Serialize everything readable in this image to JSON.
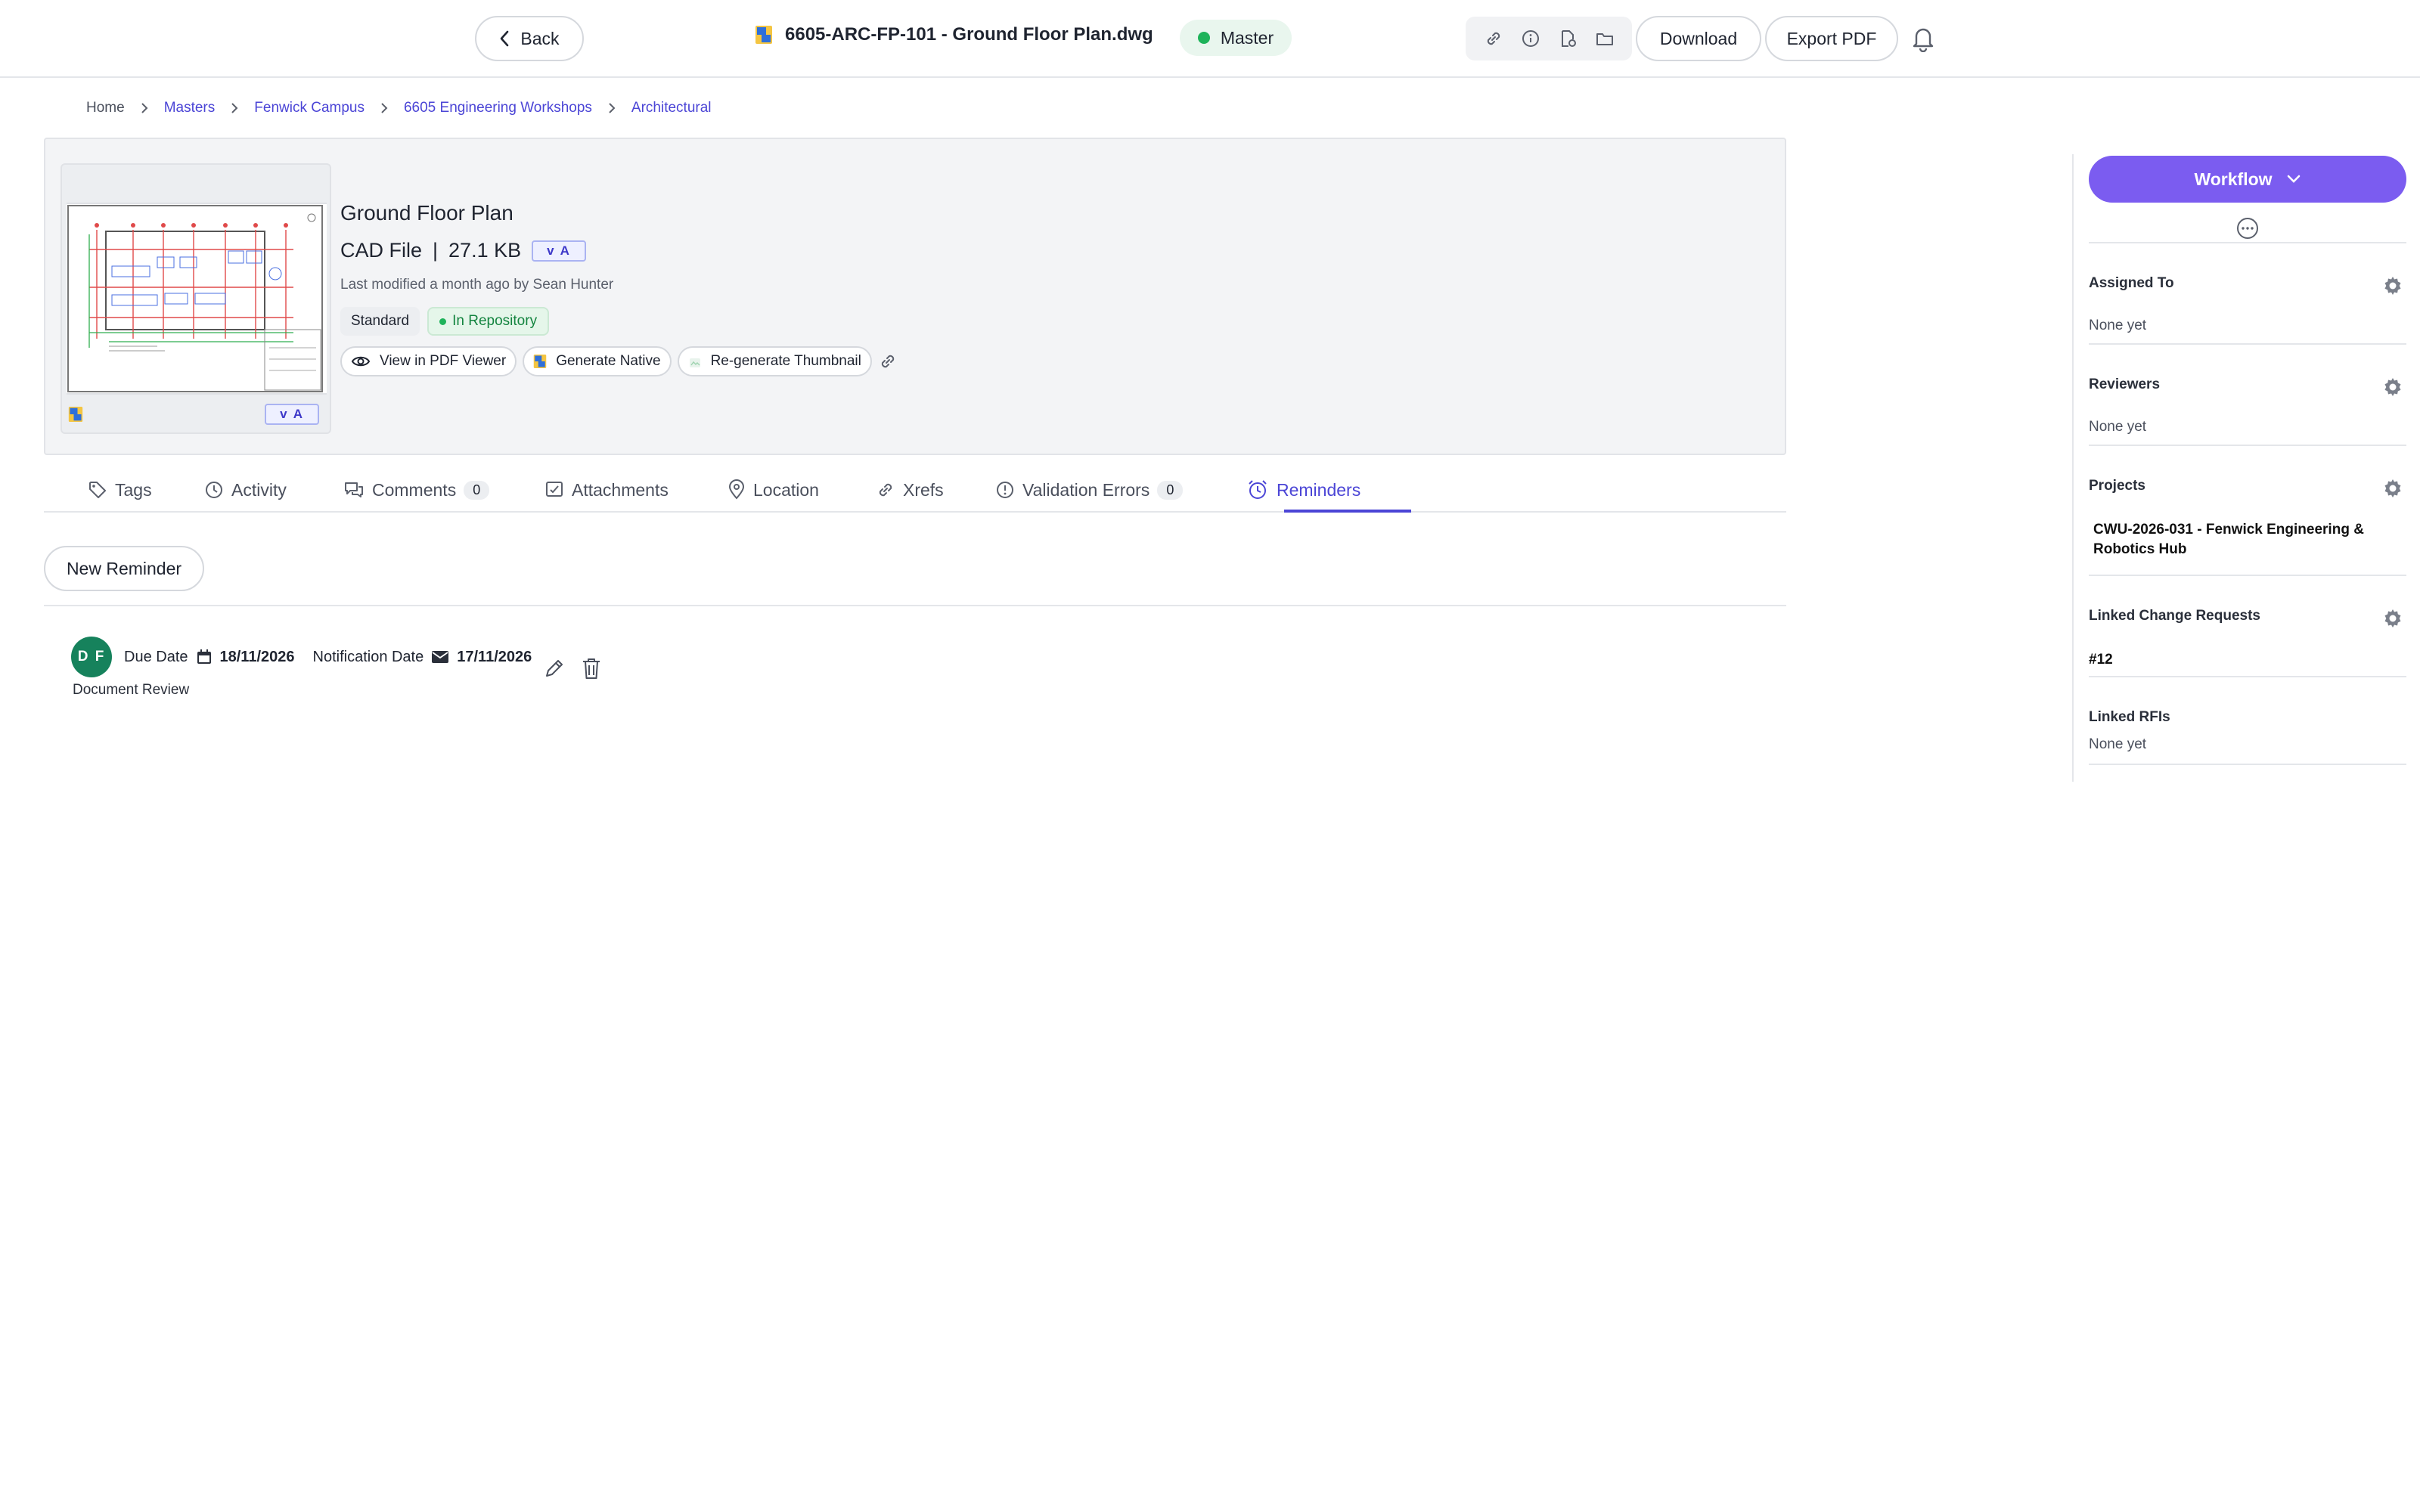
{
  "topbar": {
    "back_label": "Back",
    "file_name": "6605-ARC-FP-101 - Ground Floor Plan.dwg",
    "status_label": "Master",
    "download_label": "Download",
    "export_label": "Export PDF",
    "colors": {
      "status_dot": "#1eb35a",
      "accent": "#4b45d6"
    }
  },
  "breadcrumb": [
    "Home",
    "Masters",
    "Fenwick Campus",
    "6605 Engineering Workshops",
    "Architectural"
  ],
  "file": {
    "title": "Ground Floor Plan",
    "type": "CAD File",
    "separator": "|",
    "size": "27.1 KB",
    "version": "v A",
    "modified": "Last modified a month ago by Sean Hunter",
    "tags": {
      "standard": "Standard",
      "repository": "In Repository"
    },
    "actions": {
      "view_pdf": "View in PDF Viewer",
      "generate_native": "Generate Native",
      "regen_thumb": "Re-generate Thumbnail"
    },
    "thumb_version": "v A"
  },
  "tabs": [
    {
      "label": "Tags",
      "icon": "tag-icon"
    },
    {
      "label": "Activity",
      "icon": "clock-icon"
    },
    {
      "label": "Comments",
      "icon": "comments-icon",
      "count": "0"
    },
    {
      "label": "Attachments",
      "icon": "attachment-icon"
    },
    {
      "label": "Location",
      "icon": "location-pin-icon"
    },
    {
      "label": "Xrefs",
      "icon": "link-icon"
    },
    {
      "label": "Validation Errors",
      "icon": "alert-circle-icon",
      "count": "0"
    },
    {
      "label": "Reminders",
      "icon": "alarm-clock-icon",
      "active": true
    }
  ],
  "reminders": {
    "new_label": "New Reminder",
    "items": [
      {
        "initials": "D F",
        "due_label": "Due Date",
        "due_date": "18/11/2026",
        "notify_label": "Notification Date",
        "notify_date": "17/11/2026",
        "title": "Document Review"
      }
    ]
  },
  "sidebar": {
    "workflow_label": "Workflow",
    "sections": [
      {
        "label": "Assigned To",
        "value": "None yet"
      },
      {
        "label": "Reviewers",
        "value": "None yet"
      },
      {
        "label": "Projects",
        "value": "CWU-2026-031 - Fenwick Engineering & Robotics Hub"
      },
      {
        "label": "Linked Change Requests",
        "value": "#12"
      },
      {
        "label": "Linked RFIs",
        "value": "None yet"
      }
    ],
    "colors": {
      "workflow": "#7b5cf0"
    }
  }
}
